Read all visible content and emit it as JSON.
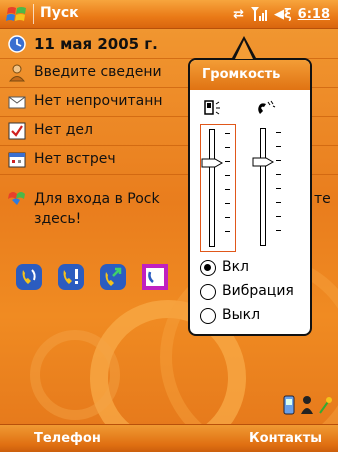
{
  "titlebar": {
    "start_label": "Пуск",
    "time": "6:18"
  },
  "today": {
    "date": "11 мая 2005 г.",
    "owner": "Введите сведени",
    "messages": "Нет непрочитанн",
    "tasks": "Нет дел",
    "calendar": "Нет встреч",
    "info_line1": "Для входа в Pock",
    "info_line1_tail": "те",
    "info_line2": "здесь!"
  },
  "volume_popup": {
    "title": "Громкость",
    "system_volume": 0.73,
    "ringer_volume": 0.73,
    "options": [
      "Вкл",
      "Вибрация",
      "Выкл"
    ],
    "selected_option": "Вкл"
  },
  "softkeys": {
    "left": "Телефон",
    "right": "Контакты"
  },
  "colors": {
    "accent": "#e97d1d",
    "popup_header": "#f39d36",
    "slider_frame": "#e0571a"
  }
}
